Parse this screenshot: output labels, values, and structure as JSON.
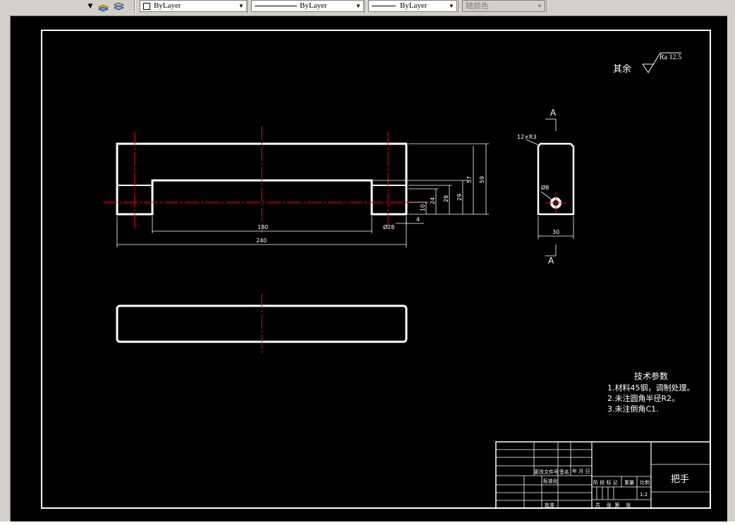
{
  "toolbar": {
    "layer_combo": "ByLayer",
    "linetype_combo": "ByLayer",
    "lineweight_combo": "ByLayer",
    "plotstyle_combo": "随颜色"
  },
  "drawing": {
    "roughness_prefix": "其余",
    "roughness_value": "Ra 12.5",
    "section_label_top": "A",
    "section_label_bottom": "A",
    "fillet_note": "12×R3",
    "hole_diameter_side": "Ø8",
    "dim_180": "180",
    "dim_240": "240",
    "dim_diam28": "Ø28",
    "dim_4": "4",
    "dim_10": "10",
    "dim_24": "24",
    "dim_28": "28",
    "dim_29": "29",
    "dim_57": "57",
    "dim_59": "59",
    "dim_30": "30"
  },
  "tech": {
    "title": "技术参数",
    "line1": "1.材料45钢，调制处理。",
    "line2": "2.未注圆角半径R2。",
    "line3": "3.未注倒角C1."
  },
  "title_block": {
    "part_name": "把手",
    "change_doc": "更改文件号",
    "signature": "签名",
    "date": "年 月 日",
    "standardize": "标准化",
    "approve": "批准",
    "stage_mark": "阶 段 标 记",
    "weight": "重量",
    "ratio_label": "比例",
    "ratio_value": "1:2",
    "sheets": "共    张  第    张"
  },
  "colors": {
    "model_bg": "#000000",
    "geometry": "#ffffff",
    "centerline": "#ff0000"
  }
}
